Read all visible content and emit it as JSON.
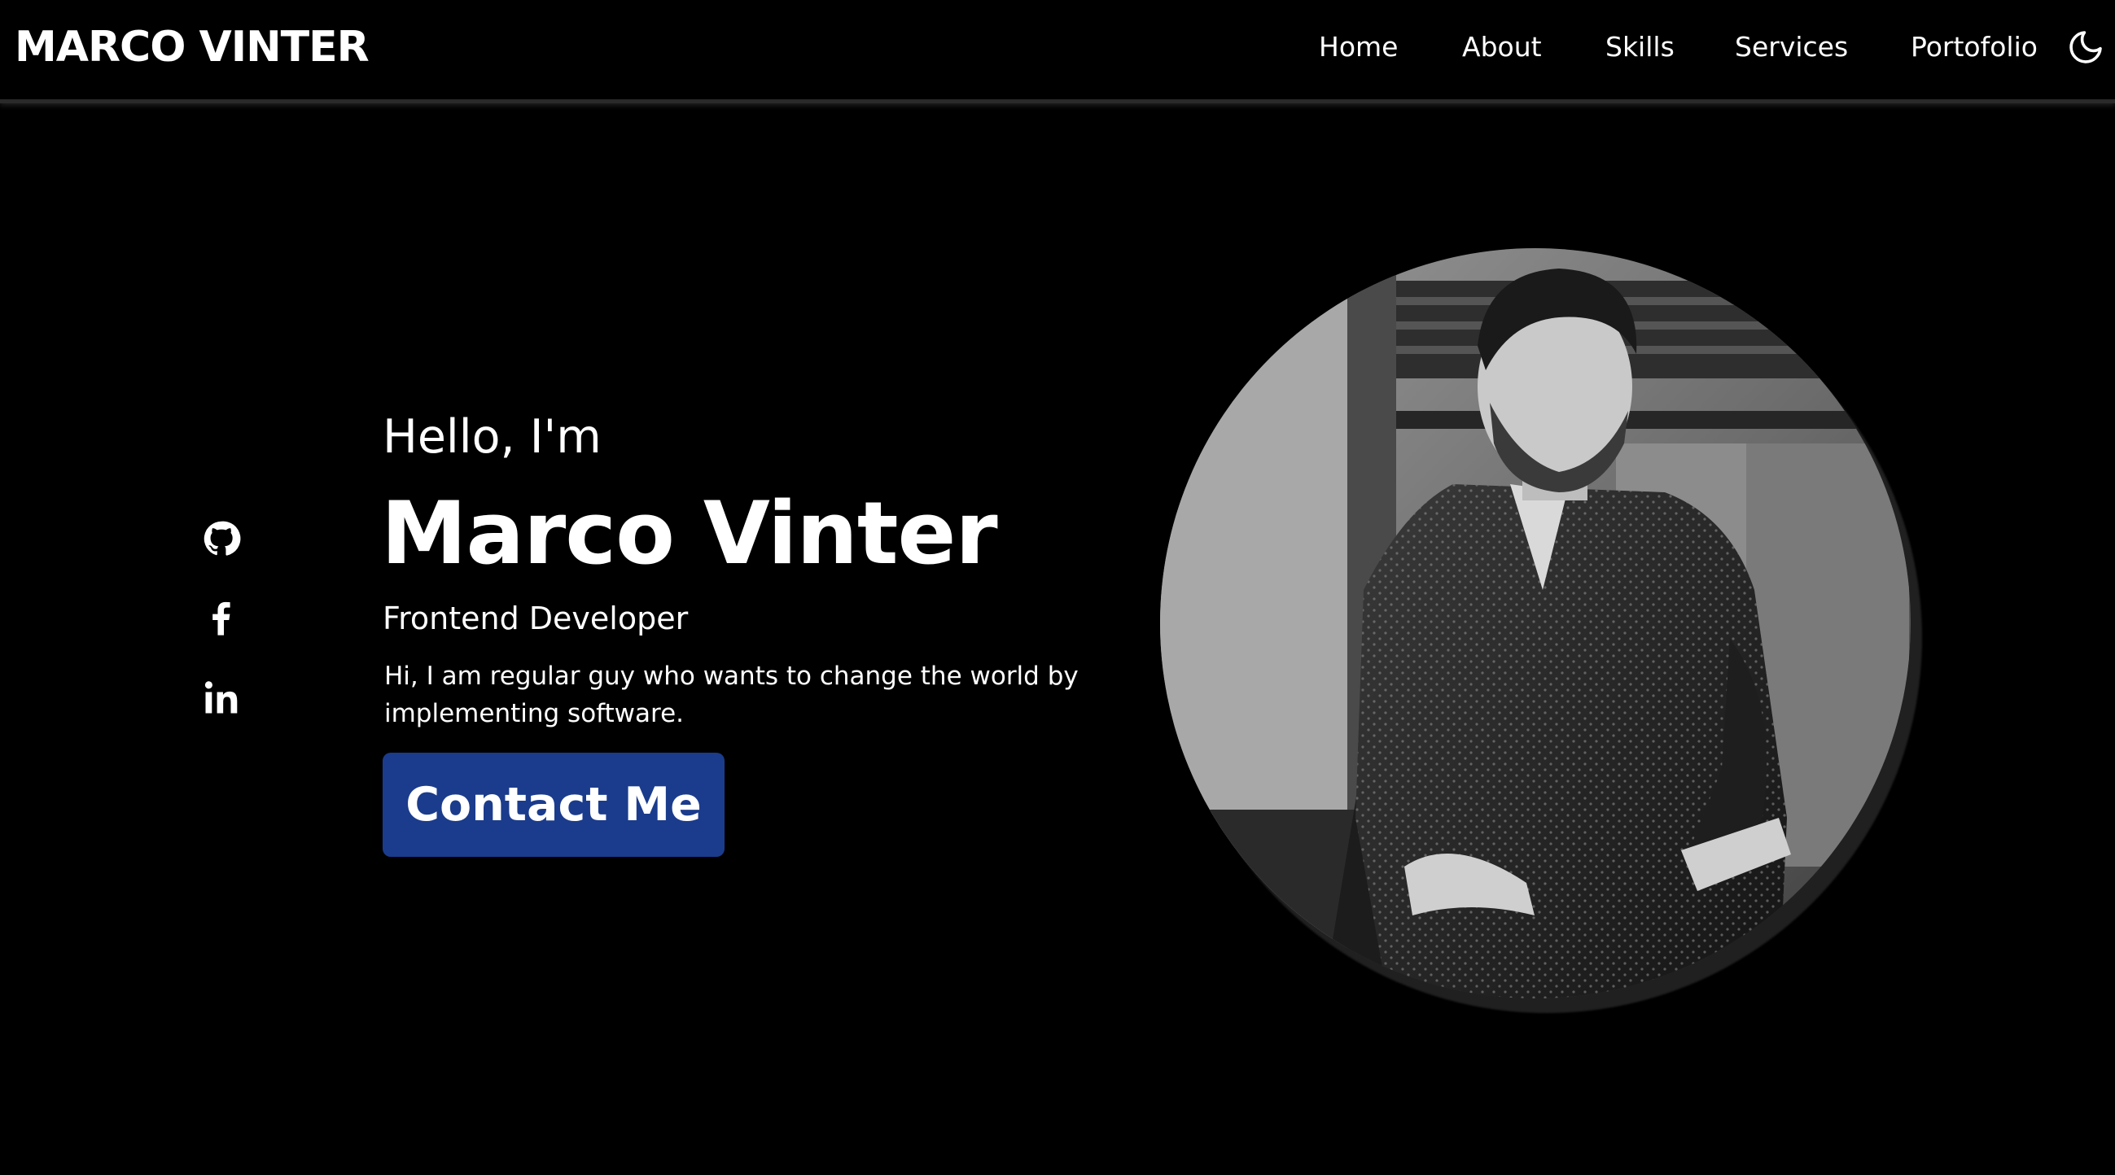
{
  "header": {
    "logo": "MARCO VINTER",
    "nav": [
      "Home",
      "About",
      "Skills",
      "Services",
      "Portofolio"
    ],
    "theme_icon": "moon-icon"
  },
  "socials": [
    {
      "icon": "github-icon"
    },
    {
      "icon": "facebook-icon"
    },
    {
      "icon": "linkedin-icon"
    }
  ],
  "hero": {
    "greeting": "Hello, I'm",
    "name": "Marco Vinter",
    "role": "Frontend Developer",
    "bio": "Hi, I am regular guy who wants to change the world by implementing software.",
    "cta_label": "Contact Me"
  },
  "colors": {
    "background": "#000000",
    "text": "#ffffff",
    "accent": "#1b3c8c"
  }
}
